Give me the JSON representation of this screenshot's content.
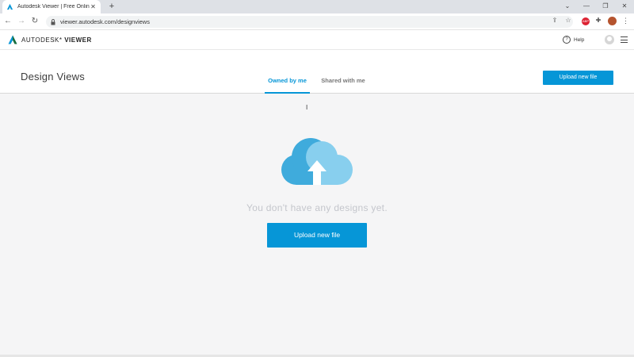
{
  "browser": {
    "tab_title": "Autodesk Viewer | Free Online Fi",
    "tab_close": "✕",
    "new_tab": "+",
    "url": "viewer.autodesk.com/designviews",
    "ext_badge": "ABP",
    "window_controls": {
      "chevron": "⌄",
      "minimize": "—",
      "maximize": "❐",
      "close": "✕"
    }
  },
  "header": {
    "brand_prefix": "AUTODESK",
    "brand_suffix": "VIEWER",
    "help_label": "Help",
    "help_icon": "?"
  },
  "page": {
    "title": "Design Views",
    "tabs": [
      {
        "label": "Owned by me",
        "active": true
      },
      {
        "label": "Shared with me",
        "active": false
      }
    ],
    "upload_button_top": "Upload new file"
  },
  "empty_state": {
    "message": "You don't have any designs yet.",
    "upload_button": "Upload new file",
    "cursor_glyph": "I"
  },
  "colors": {
    "accent": "#0696d7",
    "cloud_dark": "#3fabdc",
    "cloud_light": "#88cfee"
  }
}
